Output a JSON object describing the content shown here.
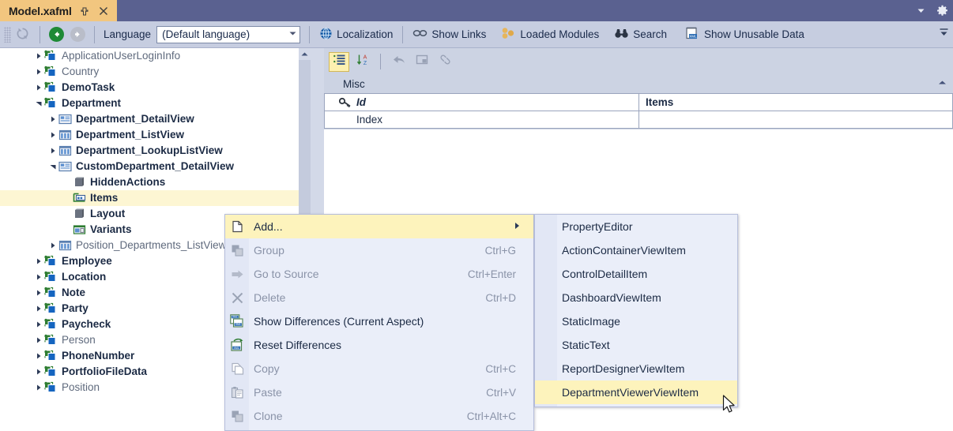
{
  "titlebar": {
    "tab_title": "Model.xafml",
    "pin_icon": "pin-icon",
    "close_icon": "close-icon",
    "dropdown_icon": "chevron-down-icon",
    "settings_icon": "gear-icon"
  },
  "toolbar": {
    "grip": "drag-grip",
    "refresh_icon": "refresh-icon",
    "back_icon": "back-arrow-icon",
    "forward_icon": "forward-arrow-icon",
    "language_label": "Language",
    "language_value": "(Default language)",
    "buttons": [
      {
        "label": "Localization",
        "icon": "globe-icon"
      },
      {
        "label": "Show Links",
        "icon": "link-chain-icon"
      },
      {
        "label": "Loaded Modules",
        "icon": "modules-icon"
      },
      {
        "label": "Search",
        "icon": "binoculars-icon"
      },
      {
        "label": "Show Unusable Data",
        "icon": "xml-data-icon"
      }
    ],
    "overflow_icon": "toolbar-overflow-icon"
  },
  "tree": {
    "nodes": [
      {
        "label": "ApplicationUserLoginInfo",
        "indent": 1,
        "expander": "collapsed",
        "icon": "class-icon",
        "style": "normal"
      },
      {
        "label": "Country",
        "indent": 1,
        "expander": "collapsed",
        "icon": "class-icon",
        "style": "normal"
      },
      {
        "label": "DemoTask",
        "indent": 1,
        "expander": "collapsed",
        "icon": "class-icon",
        "style": "bold"
      },
      {
        "label": "Department",
        "indent": 1,
        "expander": "expanded",
        "icon": "class-icon",
        "style": "bold"
      },
      {
        "label": "Department_DetailView",
        "indent": 2,
        "expander": "collapsed",
        "icon": "detailview-icon",
        "style": "bold"
      },
      {
        "label": "Department_ListView",
        "indent": 2,
        "expander": "collapsed",
        "icon": "listview-icon",
        "style": "bold"
      },
      {
        "label": "Department_LookupListView",
        "indent": 2,
        "expander": "collapsed",
        "icon": "listview-icon",
        "style": "bold"
      },
      {
        "label": "CustomDepartment_DetailView",
        "indent": 2,
        "expander": "expanded",
        "icon": "detailview-icon",
        "style": "bold"
      },
      {
        "label": "HiddenActions",
        "indent": 3,
        "expander": "none",
        "icon": "node-icon",
        "style": "bold"
      },
      {
        "label": "Items",
        "indent": 3,
        "expander": "none",
        "icon": "items-icon",
        "style": "bold",
        "selected": true
      },
      {
        "label": "Layout",
        "indent": 3,
        "expander": "none",
        "icon": "node-icon",
        "style": "bold"
      },
      {
        "label": "Variants",
        "indent": 3,
        "expander": "none",
        "icon": "variants-icon",
        "style": "bold"
      },
      {
        "label": "Position_Departments_ListView",
        "indent": 2,
        "expander": "collapsed",
        "icon": "listview-icon",
        "style": "normal"
      },
      {
        "label": "Employee",
        "indent": 1,
        "expander": "collapsed",
        "icon": "class-icon",
        "style": "bold"
      },
      {
        "label": "Location",
        "indent": 1,
        "expander": "collapsed",
        "icon": "class-icon",
        "style": "bold"
      },
      {
        "label": "Note",
        "indent": 1,
        "expander": "collapsed",
        "icon": "class-icon",
        "style": "bold"
      },
      {
        "label": "Party",
        "indent": 1,
        "expander": "collapsed",
        "icon": "class-icon",
        "style": "bold"
      },
      {
        "label": "Paycheck",
        "indent": 1,
        "expander": "collapsed",
        "icon": "class-icon",
        "style": "bold"
      },
      {
        "label": "Person",
        "indent": 1,
        "expander": "collapsed",
        "icon": "class-icon",
        "style": "normal"
      },
      {
        "label": "PhoneNumber",
        "indent": 1,
        "expander": "collapsed",
        "icon": "class-icon",
        "style": "bold"
      },
      {
        "label": "PortfolioFileData",
        "indent": 1,
        "expander": "collapsed",
        "icon": "class-icon",
        "style": "bold"
      },
      {
        "label": "Position",
        "indent": 1,
        "expander": "collapsed",
        "icon": "class-icon",
        "style": "normal"
      }
    ]
  },
  "properties": {
    "toolbar": {
      "categorized_icon": "categorized-view-icon",
      "alphabetical_icon": "sort-alphabetical-icon",
      "reset_icon": "undo-arrow-icon",
      "group_icon": "group-icon",
      "link_icon": "link-icon"
    },
    "category": "Misc",
    "collapse_icon": "collapse-chevron-icon",
    "rows": [
      {
        "name": "Id",
        "value": "Items",
        "name_icon": "key-icon",
        "name_style": "bold-italic",
        "value_style": "bold"
      },
      {
        "name": "Index",
        "value": "",
        "name_icon": "",
        "name_style": "normal",
        "value_style": "normal"
      }
    ]
  },
  "context_menu": {
    "items": [
      {
        "label": "Add...",
        "shortcut": "",
        "icon": "add-page-icon",
        "state": "highlighted",
        "submenu": true
      },
      {
        "label": "Group",
        "shortcut": "Ctrl+G",
        "icon": "group-icon",
        "state": "disabled",
        "submenu": false
      },
      {
        "label": "Go to Source",
        "shortcut": "Ctrl+Enter",
        "icon": "arrow-right-icon",
        "state": "disabled",
        "submenu": false
      },
      {
        "label": "Delete",
        "shortcut": "Ctrl+D",
        "icon": "delete-x-icon",
        "state": "disabled",
        "submenu": false
      },
      {
        "label": "Show Differences (Current Aspect)",
        "shortcut": "",
        "icon": "xml-diff-icon",
        "state": "normal",
        "submenu": false
      },
      {
        "label": "Reset Differences",
        "shortcut": "",
        "icon": "xml-reset-icon",
        "state": "normal",
        "submenu": false
      },
      {
        "label": "Copy",
        "shortcut": "Ctrl+C",
        "icon": "copy-icon",
        "state": "disabled",
        "submenu": false
      },
      {
        "label": "Paste",
        "shortcut": "Ctrl+V",
        "icon": "paste-icon",
        "state": "disabled",
        "submenu": false
      },
      {
        "label": "Clone",
        "shortcut": "Ctrl+Alt+C",
        "icon": "clone-icon",
        "state": "disabled",
        "submenu": false
      }
    ]
  },
  "submenu": {
    "items": [
      {
        "label": "PropertyEditor",
        "state": "normal"
      },
      {
        "label": "ActionContainerViewItem",
        "state": "normal"
      },
      {
        "label": "ControlDetailItem",
        "state": "normal"
      },
      {
        "label": "DashboardViewItem",
        "state": "normal"
      },
      {
        "label": "StaticImage",
        "state": "normal"
      },
      {
        "label": "StaticText",
        "state": "normal"
      },
      {
        "label": "ReportDesignerViewItem",
        "state": "normal"
      },
      {
        "label": "DepartmentViewerViewItem",
        "state": "highlighted"
      }
    ]
  },
  "cursor": {
    "icon": "mouse-pointer-icon"
  },
  "colors": {
    "tab_active": "#f2c67f",
    "titlebar": "#5a6190",
    "toolbar": "#c6cde0",
    "menu_bg": "#eaeef9",
    "highlight": "#fdf3bc",
    "tree_selection": "#fdf6d3",
    "text": "#1b2a44",
    "disabled_text": "#8a93a8"
  }
}
